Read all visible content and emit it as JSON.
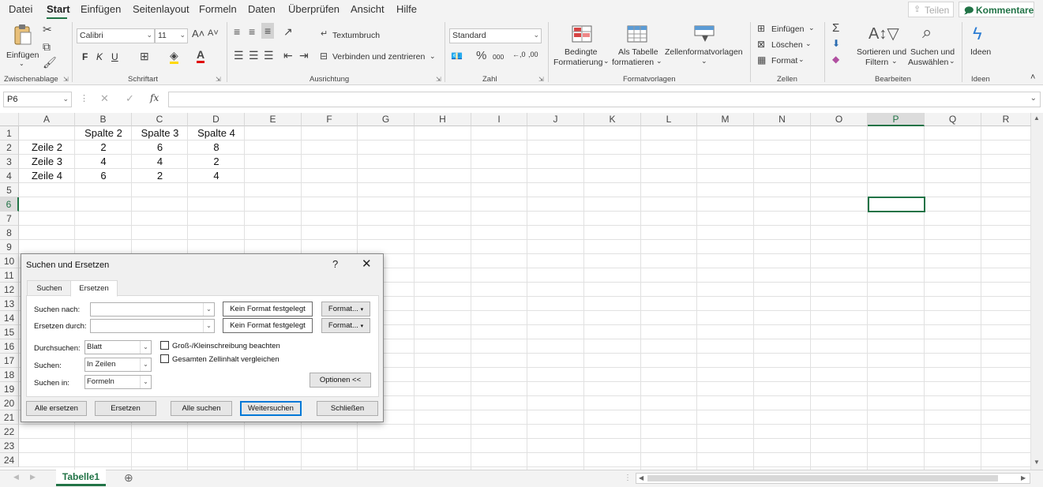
{
  "menu": {
    "items": [
      "Datei",
      "Start",
      "Einfügen",
      "Seitenlayout",
      "Formeln",
      "Daten",
      "Überprüfen",
      "Ansicht",
      "Hilfe"
    ],
    "active": "Start",
    "share": "Teilen",
    "comments": "Kommentare"
  },
  "ribbon": {
    "clipboard": {
      "paste": "Einfügen",
      "label": "Zwischenablage"
    },
    "font": {
      "name": "Calibri",
      "size": "11",
      "bold": "F",
      "italic": "K",
      "underline": "U",
      "label": "Schriftart"
    },
    "alignment": {
      "wrap": "Textumbruch",
      "merge": "Verbinden und zentrieren",
      "label": "Ausrichtung"
    },
    "number": {
      "format": "Standard",
      "label": "Zahl"
    },
    "styles": {
      "conditional_1": "Bedingte",
      "conditional_2": "Formatierung",
      "table_1": "Als Tabelle",
      "table_2": "formatieren",
      "cellstyles": "Zellenformatvorlagen",
      "label": "Formatvorlagen"
    },
    "cells": {
      "insert": "Einfügen",
      "delete": "Löschen",
      "format": "Format",
      "label": "Zellen"
    },
    "editing": {
      "sort_1": "Sortieren und",
      "sort_2": "Filtern",
      "find_1": "Suchen und",
      "find_2": "Auswählen",
      "label": "Bearbeiten"
    },
    "ideas": {
      "ideas": "Ideen",
      "label": "Ideen"
    }
  },
  "formula": {
    "namebox": "P6",
    "value": ""
  },
  "grid": {
    "columns": [
      "A",
      "B",
      "C",
      "D",
      "E",
      "F",
      "G",
      "H",
      "I",
      "J",
      "K",
      "L",
      "M",
      "N",
      "O",
      "P",
      "Q",
      "R"
    ],
    "rows": [
      "1",
      "2",
      "3",
      "4",
      "5",
      "6",
      "7",
      "8",
      "9",
      "10",
      "11",
      "12",
      "13",
      "14",
      "15",
      "16",
      "17",
      "18",
      "19",
      "20",
      "21",
      "22",
      "23",
      "24"
    ],
    "selected_column": "P",
    "selected_row": "6",
    "cells": [
      [
        "",
        "Spalte 2",
        "Spalte 3",
        "Spalte 4"
      ],
      [
        "Zeile 2",
        "2",
        "6",
        "8"
      ],
      [
        "Zeile 3",
        "4",
        "4",
        "2"
      ],
      [
        "Zeile 4",
        "6",
        "2",
        "4"
      ]
    ]
  },
  "sheets": {
    "tabs": [
      "Tabelle1"
    ]
  },
  "dialog": {
    "title": "Suchen und Ersetzen",
    "help": "?",
    "close": "✕",
    "tabs": [
      "Suchen",
      "Ersetzen"
    ],
    "active_tab": "Ersetzen",
    "search_label": "Suchen nach:",
    "search_value": "",
    "replace_label": "Ersetzen durch:",
    "replace_value": "",
    "no_format": "Kein Format festgelegt",
    "format_button": "Format...",
    "within_label": "Durchsuchen:",
    "within_value": "Blatt",
    "search_by_label": "Suchen:",
    "search_by_value": "In Zeilen",
    "look_in_label": "Suchen in:",
    "look_in_value": "Formeln",
    "match_case": "Groß-/Kleinschreibung beachten",
    "match_entire": "Gesamten Zellinhalt vergleichen",
    "options": "Optionen <<",
    "buttons": {
      "replace_all": "Alle ersetzen",
      "replace": "Ersetzen",
      "find_all": "Alle suchen",
      "find_next": "Weitersuchen",
      "close": "Schließen"
    }
  },
  "colors": {
    "accent": "#217346",
    "dialog_focus": "#0078d7"
  }
}
